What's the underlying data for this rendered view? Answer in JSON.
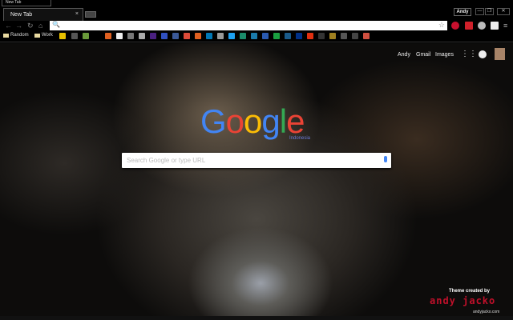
{
  "window": {
    "tiny_tab": "New Tab",
    "profile": "Andy",
    "min": "—",
    "max": "❐",
    "close": "✕"
  },
  "tab": {
    "title": "New Tab",
    "close": "×"
  },
  "omnibox": {
    "value": "",
    "search_icon": "🔍",
    "star": "☆"
  },
  "bookmarks": {
    "folders": [
      "Random",
      "Work"
    ]
  },
  "ntp": {
    "links": [
      "Andy",
      "Gmail",
      "Images"
    ],
    "logo": [
      "G",
      "o",
      "o",
      "g",
      "l",
      "e"
    ],
    "logo_sub": "Indonesia",
    "search_placeholder": "Search Google or type URL"
  },
  "theme": {
    "credit": "Theme created by",
    "brand": "andy jacko",
    "url": "andyjacko.com"
  },
  "colors": {
    "blue": "#4285f4",
    "red": "#ea4335",
    "yellow": "#fbbc05",
    "green": "#34a853"
  }
}
